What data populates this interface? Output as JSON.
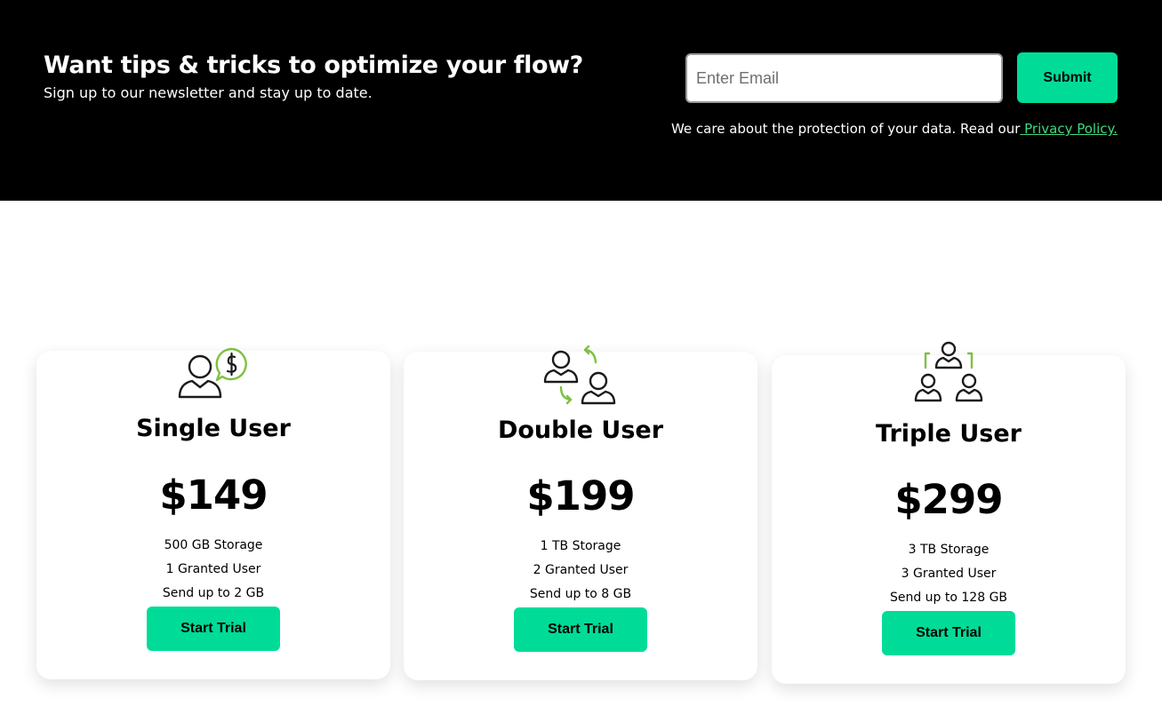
{
  "newsletter": {
    "title": "Want tips & tricks to optimize your flow?",
    "subtitle": "Sign up to our newsletter and stay up to date.",
    "email_placeholder": "Enter Email",
    "email_value": "",
    "submit_label": "Submit",
    "privacy_text": "We care about the protection of your data. Read our",
    "privacy_link": " Privacy Policy."
  },
  "plans": [
    {
      "icon": "user-dollar-icon",
      "title": "Single User",
      "price": "$149",
      "features": [
        "500 GB Storage",
        "1 Granted User",
        "Send up to 2 GB"
      ],
      "cta": "Start Trial"
    },
    {
      "icon": "user-swap-icon",
      "title": "Double User",
      "price": "$199",
      "features": [
        "1 TB Storage",
        "2 Granted User",
        "Send up to 8 GB"
      ],
      "cta": "Start Trial"
    },
    {
      "icon": "user-group-icon",
      "title": "Triple User",
      "price": "$299",
      "features": [
        "3 TB Storage",
        "3 Granted User",
        "Send up to 128 GB"
      ],
      "cta": "Start Trial"
    }
  ],
  "colors": {
    "accent": "#00dc98",
    "icon_green": "#7dc142",
    "link": "#3fd97e",
    "header_bg": "#000000"
  }
}
